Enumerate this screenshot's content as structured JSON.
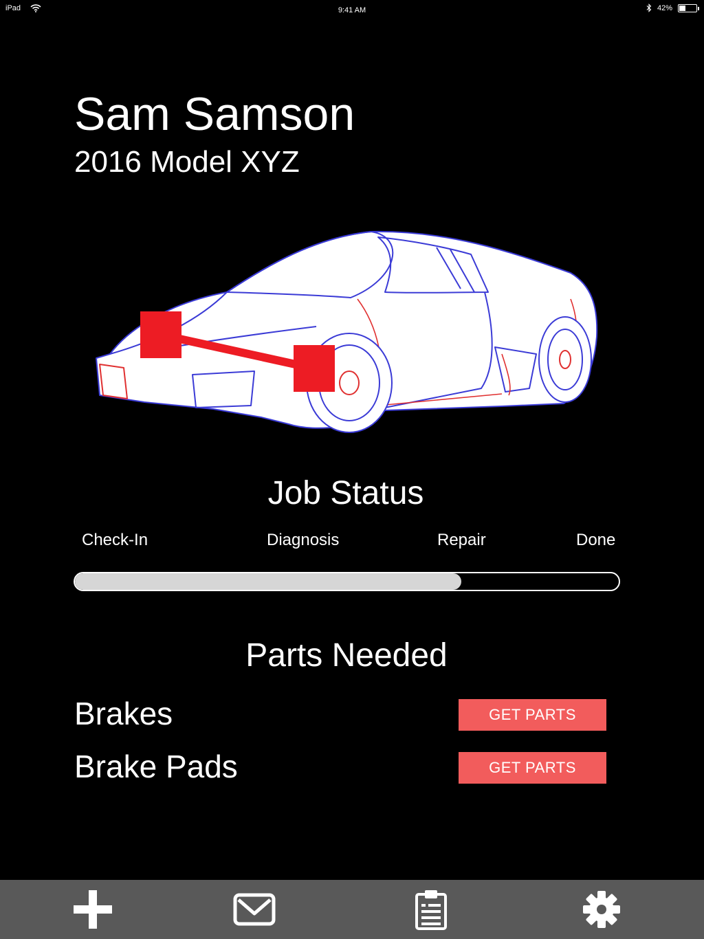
{
  "status_bar": {
    "device": "iPad",
    "time": "9:41 AM",
    "battery": "42%",
    "battery_level": 0.42
  },
  "customer": {
    "name": "Sam Samson",
    "vehicle": "2016 Model XYZ"
  },
  "job_status": {
    "title": "Job Status",
    "stages": [
      "Check-In",
      "Diagnosis",
      "Repair",
      "Done"
    ],
    "progress": 0.71
  },
  "parts": {
    "title": "Parts Needed",
    "items": [
      {
        "name": "Brakes",
        "button": "GET PARTS"
      },
      {
        "name": "Brake Pads",
        "button": "GET PARTS"
      }
    ]
  },
  "tab_bar": {
    "icons": [
      "plus-icon",
      "mail-icon",
      "clipboard-icon",
      "gear-icon"
    ]
  },
  "colors": {
    "accent": "#f25c5c",
    "marker": "#ed1c24",
    "outline": "#3b3bd6",
    "tabbar": "#595959",
    "progress_fill": "#d6d6d6"
  }
}
